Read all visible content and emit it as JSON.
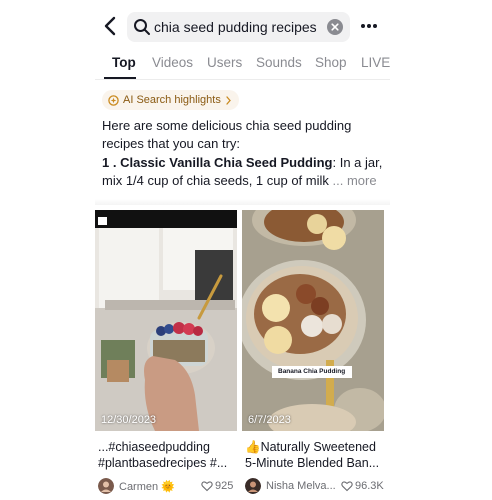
{
  "search": {
    "query": "chia seed pudding recipes"
  },
  "tabs": [
    {
      "label": "Top",
      "active": true
    },
    {
      "label": "Videos"
    },
    {
      "label": "Users"
    },
    {
      "label": "Sounds"
    },
    {
      "label": "Shop"
    },
    {
      "label": "LIVE"
    }
  ],
  "ai": {
    "badge": "AI Search highlights",
    "intro": "Here are some delicious chia seed pudding recipes that you can try:",
    "items": [
      {
        "num": "1 .",
        "title": "Classic Vanilla Chia Seed Pudding",
        "text": ": In a jar, mix 1/4 cup of chia seeds, 1 cup of milk",
        "more": "... more"
      }
    ]
  },
  "videos": [
    {
      "date": "12/30/2023",
      "caption_line1": "...#chiaseedpudding",
      "caption_line2": "#plantbasedrecipes #...",
      "author": "Carmen",
      "author_emoji": "🌞",
      "likes": "925"
    },
    {
      "date": "6/7/2023",
      "overlay": "Banana Chia Pudding",
      "caption_emoji": "👍",
      "caption_line1": "Naturally Sweetened",
      "caption_line2": "5-Minute Blended Ban...",
      "author": "Nisha Melva...",
      "likes": "96.3K"
    }
  ],
  "colors": {
    "accent": "#161823",
    "muted": "#8a8b91",
    "ai_badge": "#8a5a12"
  }
}
